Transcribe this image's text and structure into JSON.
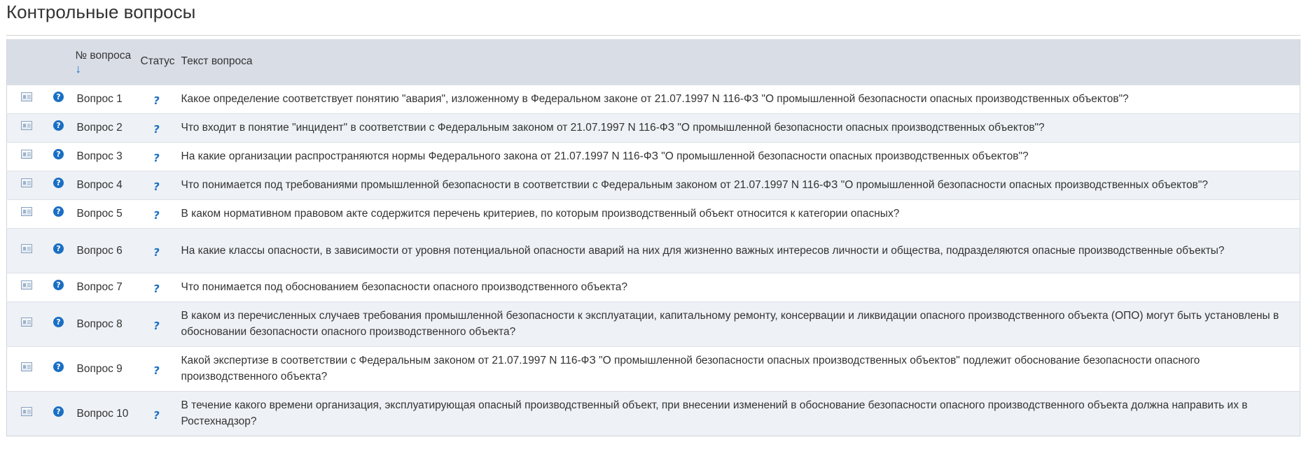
{
  "page": {
    "title": "Контрольные вопросы"
  },
  "table": {
    "headers": {
      "number": "№ вопроса",
      "sort_indicator": "↓",
      "status": "Статус",
      "text": "Текст вопроса"
    },
    "icons": {
      "details": "card-icon",
      "help": "help-circle-icon",
      "status": "question-mark-icon",
      "help_glyph": "?",
      "status_glyph": "?"
    },
    "rows": [
      {
        "number": "Вопрос 1",
        "text": "Какое определение соответствует понятию \"авария\", изложенному в Федеральном законе от 21.07.1997 N 116-ФЗ \"О промышленной безопасности опасных производственных объектов\"?"
      },
      {
        "number": "Вопрос 2",
        "text": "Что входит в понятие \"инцидент\" в соответствии с Федеральным законом от 21.07.1997 N 116-ФЗ \"О промышленной безопасности опасных производственных объектов\"?"
      },
      {
        "number": "Вопрос 3",
        "text": "На какие организации распространяются нормы Федерального закона от 21.07.1997 N 116-ФЗ \"О промышленной безопасности опасных производственных объектов\"?"
      },
      {
        "number": "Вопрос 4",
        "text": "Что понимается под требованиями промышленной безопасности в соответствии с Федеральным законом от 21.07.1997 N 116-ФЗ \"О промышленной безопасности опасных производственных объектов\"?"
      },
      {
        "number": "Вопрос 5",
        "text": "В каком нормативном правовом акте содержится перечень критериев, по которым производственный объект относится к категории опасных?"
      },
      {
        "number": "Вопрос 6",
        "text": "На какие классы опасности, в зависимости от уровня потенциальной опасности аварий на них для жизненно важных интересов личности и общества, подразделяются опасные производственные объекты?"
      },
      {
        "number": "Вопрос 7",
        "text": "Что понимается под обоснованием безопасности опасного производственного объекта?"
      },
      {
        "number": "Вопрос 8",
        "text": "В каком из перечисленных случаев требования промышленной безопасности к эксплуатации, капитальному ремонту, консервации и ликвидации опасного производственного объекта (ОПО) могут быть установлены в обосновании безопасности опасного производственного объекта?"
      },
      {
        "number": "Вопрос 9",
        "text": "Какой экспертизе в соответствии с Федеральным законом от 21.07.1997 N 116-ФЗ \"О промышленной безопасности опасных производственных объектов\" подлежит обоснование безопасности опасного производственного объекта?"
      },
      {
        "number": "Вопрос 10",
        "text": "В течение какого времени организация, эксплуатирующая опасный производственный объект, при внесении изменений в обоснование безопасности опасного производственного объекта должна направить их в Ростехнадзор?"
      }
    ]
  }
}
